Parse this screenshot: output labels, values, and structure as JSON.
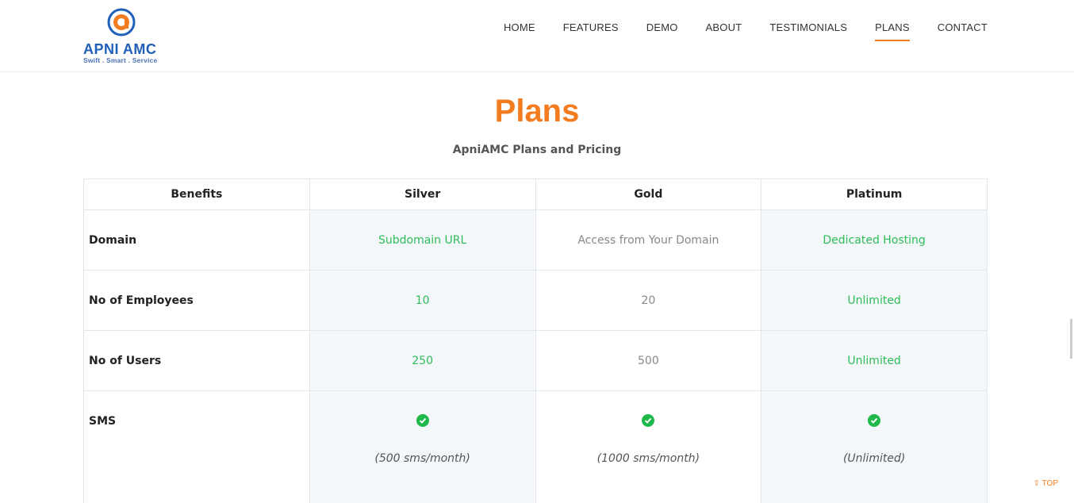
{
  "brand": {
    "name": "APNI AMC",
    "tagline": "Swift . Smart . Service",
    "colors": {
      "orange": "#f47c20",
      "blue": "#1f5fb8"
    }
  },
  "nav": {
    "items": [
      {
        "label": "HOME"
      },
      {
        "label": "FEATURES"
      },
      {
        "label": "DEMO"
      },
      {
        "label": "ABOUT"
      },
      {
        "label": "TESTIMONIALS"
      },
      {
        "label": "PLANS",
        "active": true
      },
      {
        "label": "CONTACT"
      }
    ]
  },
  "page": {
    "title": "Plans",
    "subtitle": "ApniAMC Plans and Pricing"
  },
  "table": {
    "headers": [
      "Benefits",
      "Silver",
      "Gold",
      "Platinum"
    ],
    "rows": [
      {
        "label": "Domain",
        "silver": "Subdomain URL",
        "gold": "Access from Your Domain",
        "platinum": "Dedicated Hosting"
      },
      {
        "label": "No of Employees",
        "silver": "10",
        "gold": "20",
        "platinum": "Unlimited"
      },
      {
        "label": "No of Users",
        "silver": "250",
        "gold": "500",
        "platinum": "Unlimited"
      },
      {
        "label": "SMS",
        "silver": "(500 sms/month)",
        "gold": "(1000 sms/month)",
        "platinum": "(Unlimited)"
      }
    ]
  },
  "scroll_top": {
    "label": "TOP",
    "icon": "arrow-up-icon"
  }
}
